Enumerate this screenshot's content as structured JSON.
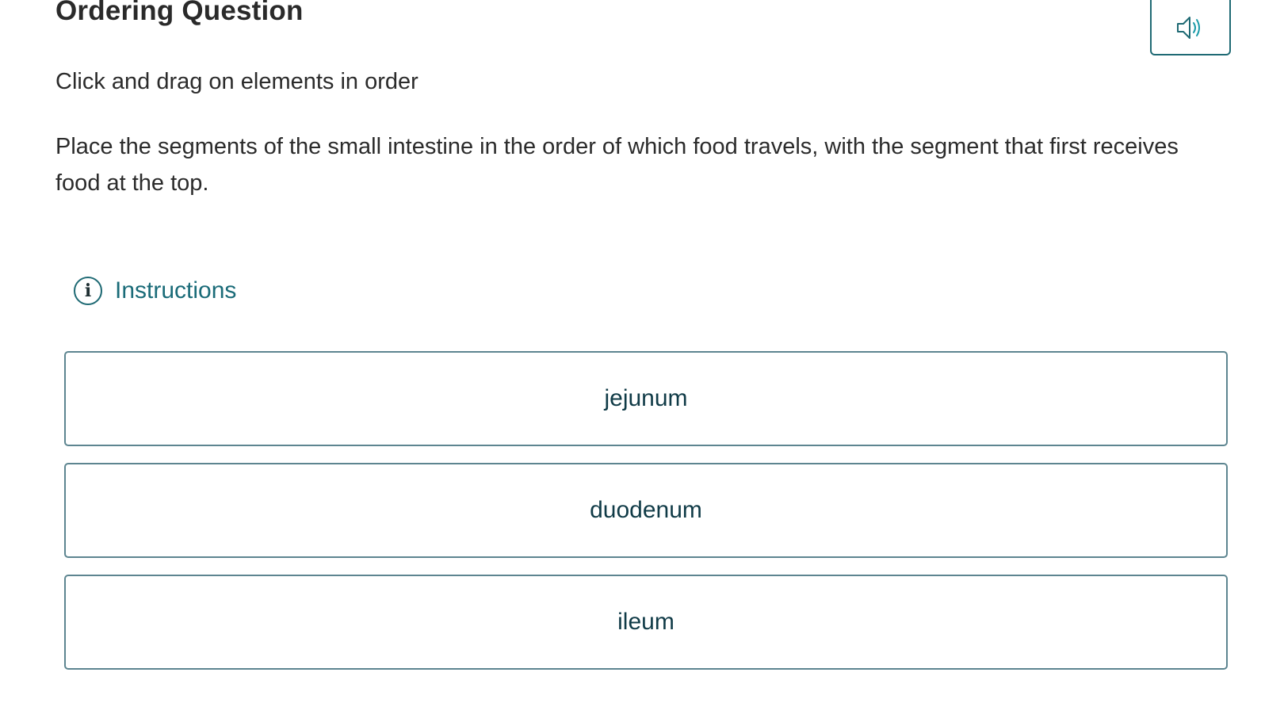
{
  "header": {
    "title": "Ordering Question"
  },
  "question": {
    "subtitle": "Click and drag on elements in order",
    "prompt": "Place the segments of the small intestine in the order of which food travels, with the segment that first receives food at the top."
  },
  "audio_button": {
    "icon": "speaker-icon"
  },
  "instructions": {
    "icon": "info-icon",
    "label": "Instructions"
  },
  "order_items": [
    {
      "label": "jejunum"
    },
    {
      "label": "duodenum"
    },
    {
      "label": "ileum"
    }
  ],
  "colors": {
    "accent": "#1a6b78",
    "border": "#5d8590",
    "item_text": "#103b47",
    "body_text": "#2b2b2b"
  }
}
